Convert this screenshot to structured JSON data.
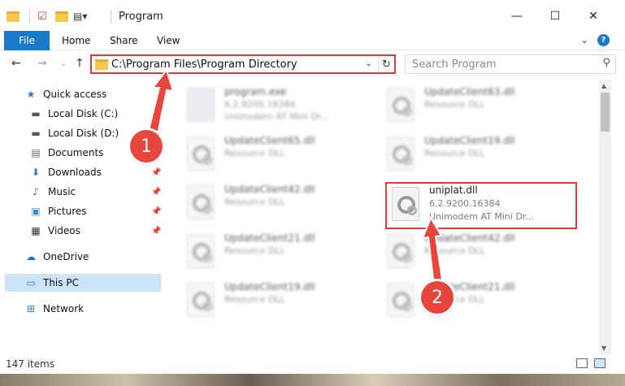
{
  "window": {
    "title": "Program",
    "minimize": "—",
    "maximize": "☐",
    "close": "✕"
  },
  "ribbon": {
    "tabs": [
      "File",
      "Home",
      "Share",
      "View"
    ]
  },
  "address": {
    "path": "C:\\Program Files\\Program Directory"
  },
  "search": {
    "placeholder": "Search Program"
  },
  "sidebar": {
    "items": [
      {
        "label": "Quick access",
        "icon": "star-icon"
      },
      {
        "label": "Local Disk (C:)",
        "icon": "drive-icon"
      },
      {
        "label": "Local Disk (D:)",
        "icon": "drive-icon"
      },
      {
        "label": "Documents",
        "icon": "documents-icon"
      },
      {
        "label": "Downloads",
        "icon": "download-icon"
      },
      {
        "label": "Music",
        "icon": "music-icon"
      },
      {
        "label": "Pictures",
        "icon": "pictures-icon"
      },
      {
        "label": "Videos",
        "icon": "videos-icon"
      },
      {
        "label": "OneDrive",
        "icon": "cloud-icon"
      },
      {
        "label": "This PC",
        "icon": "computer-icon"
      },
      {
        "label": "Network",
        "icon": "network-icon"
      }
    ]
  },
  "files": [
    {
      "name": "program.exe",
      "line1": "6.2.9200.16384",
      "line2": "Unimodem AT Mini Dr..."
    },
    {
      "name": "UpdateClient63.dll",
      "line1": "Resource DLL",
      "line2": ""
    },
    {
      "name": "UpdateClient65.dll",
      "line1": "Resource DLL",
      "line2": ""
    },
    {
      "name": "UpdateClient19.dll",
      "line1": "Resource DLL",
      "line2": ""
    },
    {
      "name": "UpdateClient42.dll",
      "line1": "Resource DLL",
      "line2": ""
    },
    {
      "name": "uniplat.dll",
      "line1": "6.2.9200.16384",
      "line2": "Unimodem AT Mini Dr..."
    },
    {
      "name": "UpdateClient21.dll",
      "line1": "Resource DLL",
      "line2": ""
    },
    {
      "name": "UpdateClient42.dll",
      "line1": "Resource DLL",
      "line2": ""
    },
    {
      "name": "UpdateClient19.dll",
      "line1": "Resource DLL",
      "line2": ""
    },
    {
      "name": "UpdateClient21.dll",
      "line1": "Resource DLL",
      "line2": ""
    }
  ],
  "status": {
    "count": "147 items"
  },
  "callouts": [
    "1",
    "2"
  ],
  "colors": {
    "accent": "#1979ca",
    "highlight": "#e23a3a",
    "selected": "#cce4f7"
  }
}
